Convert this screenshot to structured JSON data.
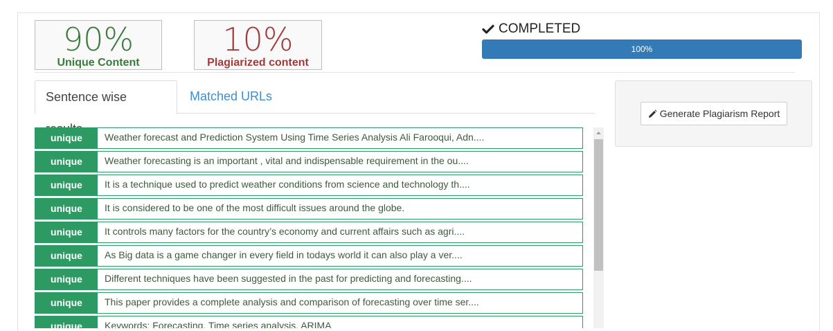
{
  "stats": {
    "unique_value": "90%",
    "unique_label": "Unique Content",
    "plag_value": "10%",
    "plag_label": "Plagiarized content"
  },
  "status": {
    "icon": "check-icon",
    "text": "COMPLETED",
    "progress_label": "100%",
    "progress_fraction": 1.0
  },
  "tabs": [
    {
      "label": "Sentence wise results",
      "active": true
    },
    {
      "label": "Matched URLs",
      "active": false
    }
  ],
  "results": [
    {
      "badge": "unique",
      "text": "Weather forecast and Prediction System Using Time Series Analysis Ali Farooqui, Adn...."
    },
    {
      "badge": "unique",
      "text": "Weather forecasting is an important , vital and indispensable requirement in the ou...."
    },
    {
      "badge": "unique",
      "text": "It is a technique used to predict weather conditions from science and technology th...."
    },
    {
      "badge": "unique",
      "text": "It is considered to be one of the most difficult issues around the globe."
    },
    {
      "badge": "unique",
      "text": "It controls many factors for the country’s economy and current affairs such as agri...."
    },
    {
      "badge": "unique",
      "text": "As Big data is a game changer in every field in todays world it can also play a ver...."
    },
    {
      "badge": "unique",
      "text": "Different techniques have been suggested in the past for predicting and forecasting...."
    },
    {
      "badge": "unique",
      "text": "This paper provides a complete analysis and comparison of forecasting over time ser...."
    },
    {
      "badge": "unique",
      "text": "Keywords: Forecasting, Time series analysis, ARIMA"
    }
  ],
  "report": {
    "icon": "pencil-icon",
    "button_label": "Generate Plagiarism Report"
  },
  "colors": {
    "unique_green": "#2e9a63",
    "plag_red": "#a33a3a",
    "progress_blue": "#337ab7",
    "link_blue": "#3a8fd0"
  }
}
